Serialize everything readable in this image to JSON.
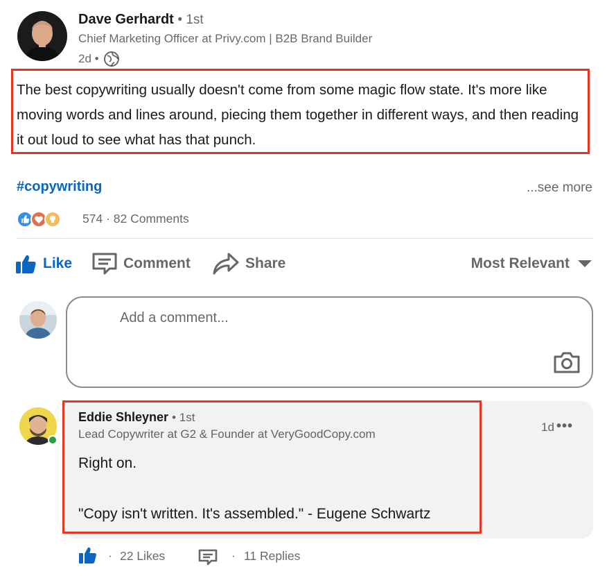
{
  "post": {
    "author": {
      "name": "Dave Gerhardt",
      "degree": "• 1st",
      "headline": "Chief Marketing Officer at Privy.com | B2B Brand Builder",
      "time": "2d •",
      "visibility_icon": "globe-icon"
    },
    "text": "The best copywriting usually doesn't come from some magic flow state. It's more like moving words and lines around, piecing them together in different ways, and then reading it out loud to see what has that punch.",
    "hashtag": "#copywriting",
    "see_more": "...see more",
    "reaction_icons": [
      "like-reaction-icon",
      "love-reaction-icon",
      "insightful-reaction-icon"
    ],
    "reaction_count": "574",
    "separator": "·",
    "comments_count": "82 Comments"
  },
  "actions": {
    "like": "Like",
    "comment": "Comment",
    "share": "Share",
    "sort": "Most Relevant"
  },
  "composer": {
    "placeholder": "Add a comment..."
  },
  "comment": {
    "name": "Eddie Shleyner",
    "degree": "• 1st",
    "headline": "Lead Copywriter at G2 & Founder at VeryGoodCopy.com",
    "time": "1d",
    "more": "•••",
    "line1": "Right on.",
    "line2": "\"Copy isn't written. It's assembled.\" - Eugene Schwartz",
    "separator": "·",
    "likes": "22 Likes",
    "replies": "11 Replies"
  },
  "colors": {
    "accent": "#0a66c2",
    "highlight": "#e8351f",
    "comment_bg": "#f2f2f2",
    "online": "#2e9e44"
  }
}
